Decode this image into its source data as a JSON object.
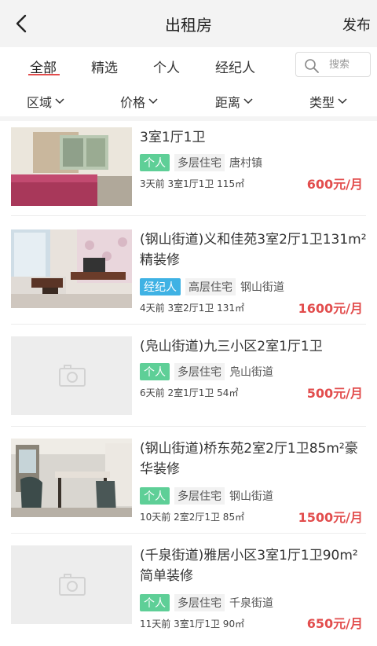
{
  "header": {
    "title": "出租房",
    "publish_label": "发布"
  },
  "tabs": [
    {
      "label": "全部"
    },
    {
      "label": "精选"
    },
    {
      "label": "个人"
    },
    {
      "label": "经纪人"
    }
  ],
  "search": {
    "placeholder": "搜索"
  },
  "filters": [
    {
      "label": "区域"
    },
    {
      "label": "价格"
    },
    {
      "label": "距离"
    },
    {
      "label": "类型"
    }
  ],
  "colors": {
    "accent": "#e24d4d",
    "personal_tag": "#5ecf97",
    "agent_tag": "#3fb2e4"
  },
  "listings": [
    {
      "title": "3室1厅1卫",
      "tag_type": "个人",
      "building": "多层住宅",
      "area": "唐村镇",
      "meta": "3天前 3室1厅1卫 115㎡",
      "price": "600元/月",
      "has_photo": true
    },
    {
      "title": "(钢山街道)义和佳苑3室2厅1卫131m²精装修",
      "tag_type": "经纪人",
      "building": "高层住宅",
      "area": "钢山街道",
      "meta": "4天前 3室2厅1卫 131㎡",
      "price": "1600元/月",
      "has_photo": true
    },
    {
      "title": "(凫山街道)九三小区2室1厅1卫",
      "tag_type": "个人",
      "building": "多层住宅",
      "area": "凫山街道",
      "meta": "6天前 2室1厅1卫 54㎡",
      "price": "500元/月",
      "has_photo": false
    },
    {
      "title": "(钢山街道)桥东苑2室2厅1卫85m²豪华装修",
      "tag_type": "个人",
      "building": "多层住宅",
      "area": "钢山街道",
      "meta": "10天前 2室2厅1卫 85㎡",
      "price": "1500元/月",
      "has_photo": true
    },
    {
      "title": "(千泉街道)雅居小区3室1厅1卫90m²简单装修",
      "tag_type": "个人",
      "building": "多层住宅",
      "area": "千泉街道",
      "meta": "11天前 3室1厅1卫 90㎡",
      "price": "650元/月",
      "has_photo": false
    }
  ]
}
